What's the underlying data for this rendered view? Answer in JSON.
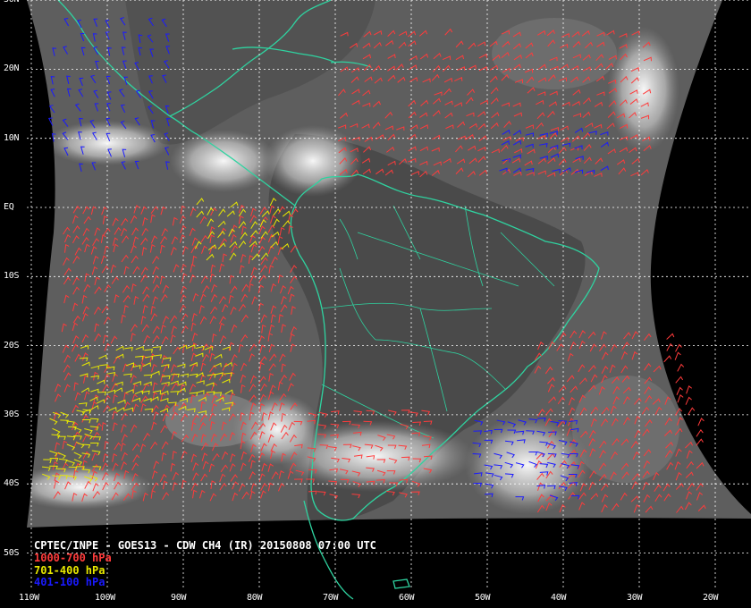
{
  "title": "CPTEC/INPE - GOES13 - CDW CH4 (IR) 20150808 07:00 UTC",
  "legend": [
    {
      "label": "1000-700 hPa",
      "color": "#ff3b3b"
    },
    {
      "label": "701-400 hPa",
      "color": "#e8e800"
    },
    {
      "label": "401-100 hPa",
      "color": "#1a1aff"
    }
  ],
  "colors": {
    "coastline": "#2fd3a0",
    "grid": "#ffffff",
    "space": "#000000"
  },
  "lat_labels": [
    {
      "text": "30N",
      "lat": 30
    },
    {
      "text": "20N",
      "lat": 20
    },
    {
      "text": "10N",
      "lat": 10
    },
    {
      "text": "EQ",
      "lat": 0
    },
    {
      "text": "10S",
      "lat": -10
    },
    {
      "text": "20S",
      "lat": -20
    },
    {
      "text": "30S",
      "lat": -30
    },
    {
      "text": "40S",
      "lat": -40
    },
    {
      "text": "50S",
      "lat": -50
    }
  ],
  "lon_labels": [
    {
      "text": "110W",
      "lon": -110
    },
    {
      "text": "100W",
      "lon": -100
    },
    {
      "text": "90W",
      "lon": -90
    },
    {
      "text": "80W",
      "lon": -80
    },
    {
      "text": "70W",
      "lon": -70
    },
    {
      "text": "60W",
      "lon": -60
    },
    {
      "text": "50W",
      "lon": -50
    },
    {
      "text": "40W",
      "lon": -40
    },
    {
      "text": "30W",
      "lon": -30
    },
    {
      "text": "20W",
      "lon": -20
    }
  ]
}
